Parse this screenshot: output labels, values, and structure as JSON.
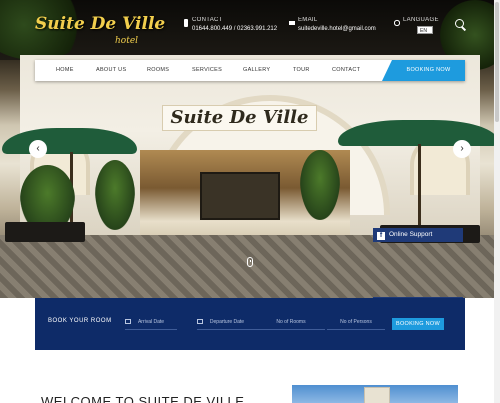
{
  "header": {
    "logo_name": "Suite De Ville",
    "logo_sub": "hotel",
    "contact_label": "CONTACT",
    "contact_value": "01644.800.449 / 02363.991.212",
    "email_label": "EMAIL",
    "email_value": "suitedeville.hotel@gmail.com",
    "language_label": "LANGUAGE",
    "language_selected": "EN"
  },
  "nav": {
    "items": [
      "HOME",
      "ABOUT US",
      "ROOMS",
      "SERVICES",
      "GALLERY",
      "TOUR",
      "CONTACT"
    ],
    "booking_label": "BOOKING NOW"
  },
  "hero": {
    "sign_text": "Suite De Ville",
    "prev_arrow": "‹",
    "next_arrow": "›"
  },
  "support": {
    "label": "Online Support"
  },
  "booking": {
    "title": "BOOK YOUR ROOM",
    "arrival_placeholder": "Arrival Date",
    "departure_placeholder": "Departure Date",
    "rooms_placeholder": "No of Rooms",
    "persons_placeholder": "No of Persons",
    "button_label": "BOOKING NOW"
  },
  "welcome": {
    "heading": "WELCOME TO SUITE DE VILLE"
  },
  "colors": {
    "accent": "#1e9bde",
    "booking_bar": "#0e2b68",
    "logo_gold": "#f2cf4d",
    "support": "#1f3a78"
  },
  "icons": [
    "phone-icon",
    "mail-icon",
    "language-icon",
    "search-icon",
    "calendar-icon",
    "facebook-icon",
    "mouse-scroll-icon"
  ]
}
